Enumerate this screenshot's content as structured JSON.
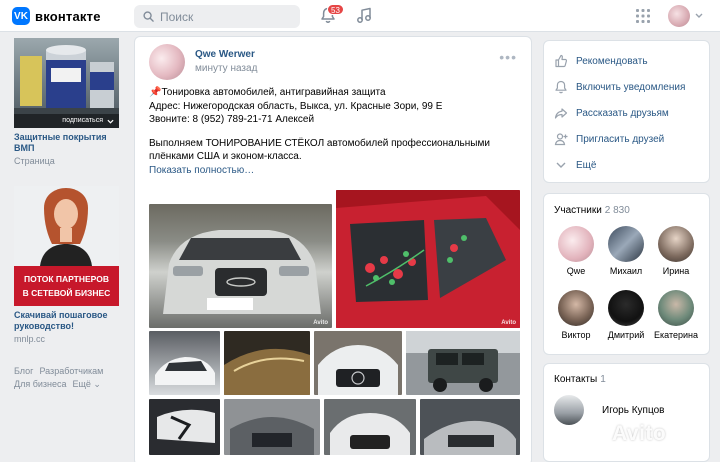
{
  "header": {
    "logo_badge": "VK",
    "logo_text": "вконтакте",
    "search_placeholder": "Поиск",
    "notifications_count": "53"
  },
  "ads": [
    {
      "overlay": "подписаться",
      "title": "Защитные покрытия ВМП",
      "subtitle": "Страница"
    },
    {
      "banner_line1": "ПОТОК ПАРТНЕРОВ",
      "banner_line2": "В СЕТЕВОЙ БИЗНЕС",
      "title": "Скачивай пошаговое руководство!",
      "subtitle": "mnlp.cc"
    }
  ],
  "footer_links": {
    "blog": "Блог",
    "developers": "Разработчикам",
    "business": "Для бизнеса",
    "more": "Ещё ⌄"
  },
  "post": {
    "author": "Qwe Werwer",
    "time": "минуту назад",
    "line1": "📌Тонировка автомобилей, антигравийная защита",
    "line2": "Адрес: Нижегородская область, Выкса, ул. Красные Зори, 99 Е",
    "line3": "Звоните: 8 (952) 789-21-71 Алексей",
    "para2": "Выполняем ТОНИРОВАНИЕ СТЁКОЛ автомобилей профессиональными плёнками США и эконом-класса.",
    "show_more": "Показать полностью…",
    "photo_watermark": "Avito"
  },
  "actions": [
    {
      "label": "Рекомендовать",
      "icon": "thumb-up-icon"
    },
    {
      "label": "Включить уведомления",
      "icon": "bell-icon"
    },
    {
      "label": "Рассказать друзьям",
      "icon": "share-icon"
    },
    {
      "label": "Пригласить друзей",
      "icon": "add-user-icon"
    },
    {
      "label": "Ещё",
      "icon": "chevron-down-icon"
    }
  ],
  "members": {
    "title": "Участники",
    "count": "2 830",
    "list": [
      "Qwe",
      "Михаил",
      "Ирина",
      "Виктор",
      "Дмитрий",
      "Екатерина"
    ]
  },
  "contacts": {
    "title": "Контакты",
    "count": "1",
    "name": "Игорь Купцов"
  },
  "watermark": "Avito",
  "colors": {
    "accent": "#0077ff",
    "link": "#2a5885",
    "muted": "#818c99",
    "badge": "#e64646",
    "background": "#edeef0"
  }
}
